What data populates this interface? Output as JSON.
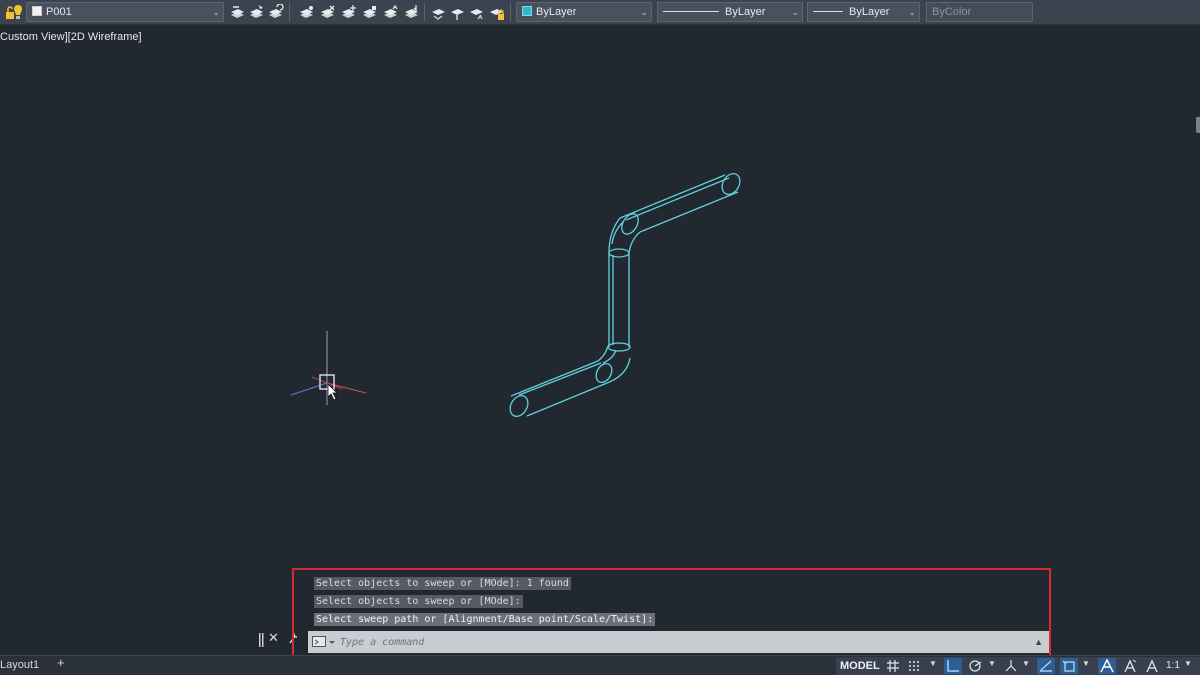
{
  "toolbar": {
    "layer_name": "P001",
    "color_value": "ByLayer",
    "linetype_value": "ByLayer",
    "lineweight_value": "ByLayer",
    "plotstyle_value": "ByColor"
  },
  "viewport": {
    "label": "Custom View][2D Wireframe]",
    "object_color": "#61d0dc"
  },
  "command_line": {
    "history": [
      "Select objects to sweep or [MOde]: 1 found",
      "Select objects to sweep or [MOde]:",
      "Select sweep path or [Alignment/Base point/Scale/Twist]:"
    ],
    "placeholder": "Type a command",
    "highlight_color": "#d42a33"
  },
  "statusbar": {
    "layout_tab": "Layout1",
    "add_tab": "+",
    "model_label": "MODEL",
    "scale_label": "1:1"
  }
}
